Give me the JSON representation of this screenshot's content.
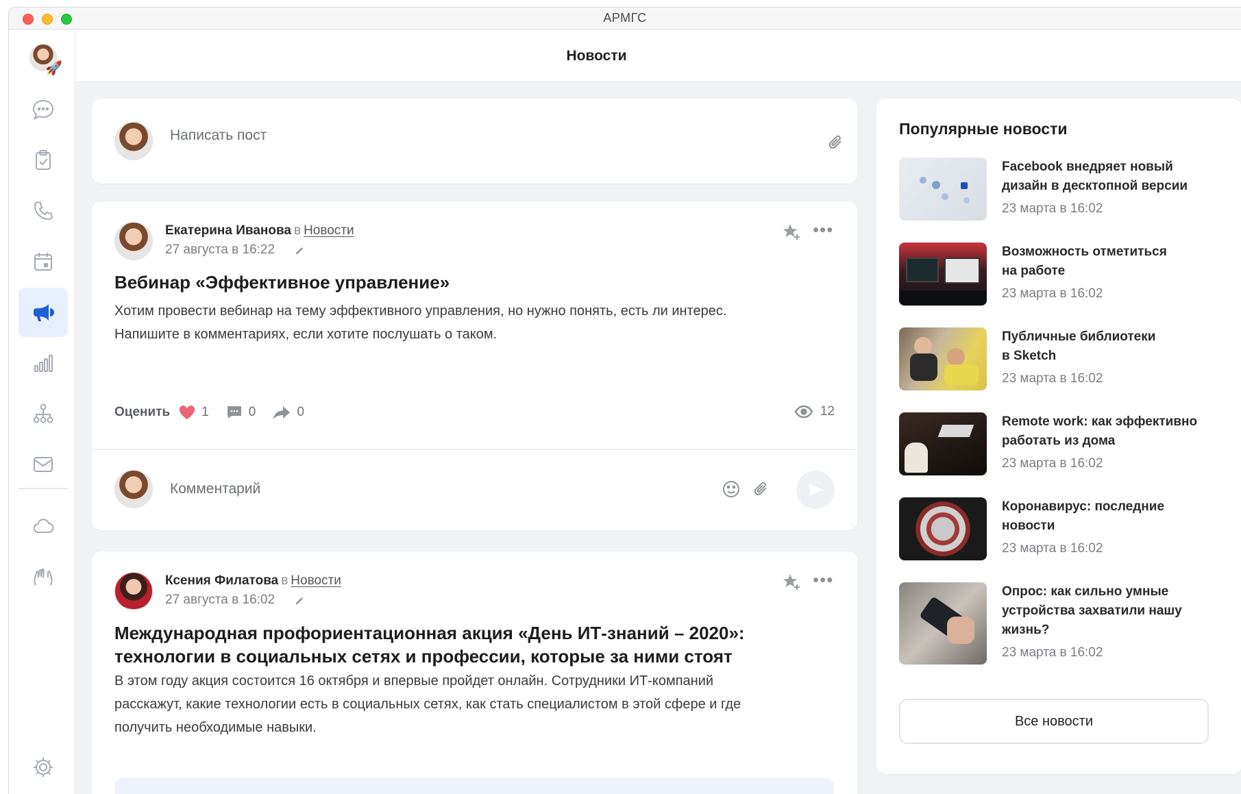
{
  "window": {
    "title": "АРМГС"
  },
  "header": {
    "title": "Новости"
  },
  "sidebar": {
    "items": [
      {
        "icon": "chat-icon",
        "label": "chat"
      },
      {
        "icon": "tasks-icon",
        "label": "tasks"
      },
      {
        "icon": "phone-icon",
        "label": "calls"
      },
      {
        "icon": "calendar-icon",
        "label": "calendar"
      },
      {
        "icon": "megaphone-icon",
        "label": "news",
        "active": true
      },
      {
        "icon": "stats-icon",
        "label": "stats"
      },
      {
        "icon": "org-structure-icon",
        "label": "structure"
      },
      {
        "icon": "mail-icon",
        "label": "mail"
      },
      {
        "icon": "cloud-icon",
        "label": "cloud"
      },
      {
        "icon": "hands-icon",
        "label": "community"
      },
      {
        "icon": "settings-icon",
        "label": "settings"
      }
    ]
  },
  "compose": {
    "placeholder": "Написать пост"
  },
  "posts": [
    {
      "author": "Екатерина Иванова",
      "in": "в",
      "channel": "Новости",
      "date": "27 августа в 16:22",
      "title": "Вебинар «Эффективное управление»",
      "body_lines": [
        "Хотим провести вебинар на тему эффективного управления, но нужно понять, есть ли интерес.",
        "Напишите в комментариях, если хотите послушать о таком."
      ],
      "rate_label": "Оценить",
      "likes": "1",
      "comments": "0",
      "shares": "0",
      "views": "12",
      "comment_placeholder": "Комментарий"
    },
    {
      "author": "Ксения Филатова",
      "in": "в",
      "channel": "Новости",
      "date": "27 августа в 16:02",
      "title_lines": [
        "Международная профориентационная акция «День ИТ-знаний – 2020»:",
        "технологии в социальных сетях и профессии, которые за ними стоят"
      ],
      "body_lines": [
        "В этом году акция состоится 16 октября и впервые пройдет онлайн. Сотрудники ИТ-компаний",
        "расскажут, какие технологии есть в социальных сетях, как стать специалистом в этой сфере и где",
        "получить необходимые навыки."
      ]
    }
  ],
  "popular": {
    "title": "Популярные новости",
    "items": [
      {
        "title_lines": [
          "Facebook внедряет новый",
          "дизайн в десктопной версии"
        ],
        "date": "23 марта в 16:02"
      },
      {
        "title_lines": [
          "Возможность отметиться",
          "на работе"
        ],
        "date": "23 марта в 16:02"
      },
      {
        "title_lines": [
          "Публичные библиотеки",
          "в Sketch"
        ],
        "date": "23 марта в 16:02"
      },
      {
        "title_lines": [
          "Remote work: как эффективно",
          "работать из дома"
        ],
        "date": "23 марта в 16:02"
      },
      {
        "title_lines": [
          "Коронавирус: последние",
          "новости"
        ],
        "date": "23 марта в 16:02"
      },
      {
        "title_lines": [
          "Опрос: как сильно умные",
          "устройства захватили нашу",
          "жизнь?"
        ],
        "date": "23 марта в 16:02"
      }
    ],
    "all_button": "Все новости"
  },
  "colors": {
    "accent": "#1f5fd6",
    "like": "#f0647a",
    "sidebar_active_bg": "#e8effc"
  }
}
